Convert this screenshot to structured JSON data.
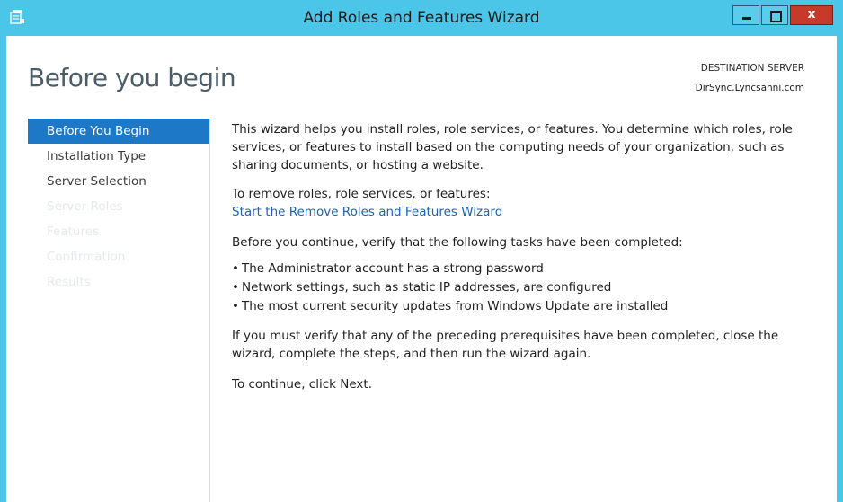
{
  "window": {
    "title": "Add Roles and Features Wizard",
    "close_glyph": "x",
    "accent_color": "#4cc6e8",
    "close_color": "#c7392b"
  },
  "header": {
    "page_title": "Before you begin",
    "destination_label": "DESTINATION SERVER",
    "destination_server": "DirSync.Lyncsahni.com"
  },
  "nav": {
    "items": [
      {
        "label": "Before You Begin",
        "state": "active"
      },
      {
        "label": "Installation Type",
        "state": "enabled"
      },
      {
        "label": "Server Selection",
        "state": "enabled"
      },
      {
        "label": "Server Roles",
        "state": "disabled"
      },
      {
        "label": "Features",
        "state": "disabled"
      },
      {
        "label": "Confirmation",
        "state": "disabled"
      },
      {
        "label": "Results",
        "state": "disabled"
      }
    ],
    "active_color": "#1e78c8"
  },
  "content": {
    "intro": "This wizard helps you install roles, role services, or features. You determine which roles, role services, or features to install based on the computing needs of your organization, such as sharing documents, or hosting a website.",
    "remove_label": "To remove roles, role services, or features:",
    "remove_link": "Start the Remove Roles and Features Wizard",
    "verify_intro": "Before you continue, verify that the following tasks have been completed:",
    "bullets": [
      "The Administrator account has a strong password",
      "Network settings, such as static IP addresses, are configured",
      "The most current security updates from Windows Update are installed"
    ],
    "verify_outro": "If you must verify that any of the preceding prerequisites have been completed, close the wizard, complete the steps, and then run the wizard again.",
    "continue_text": "To continue, click Next.",
    "link_color": "#1a63b8"
  }
}
